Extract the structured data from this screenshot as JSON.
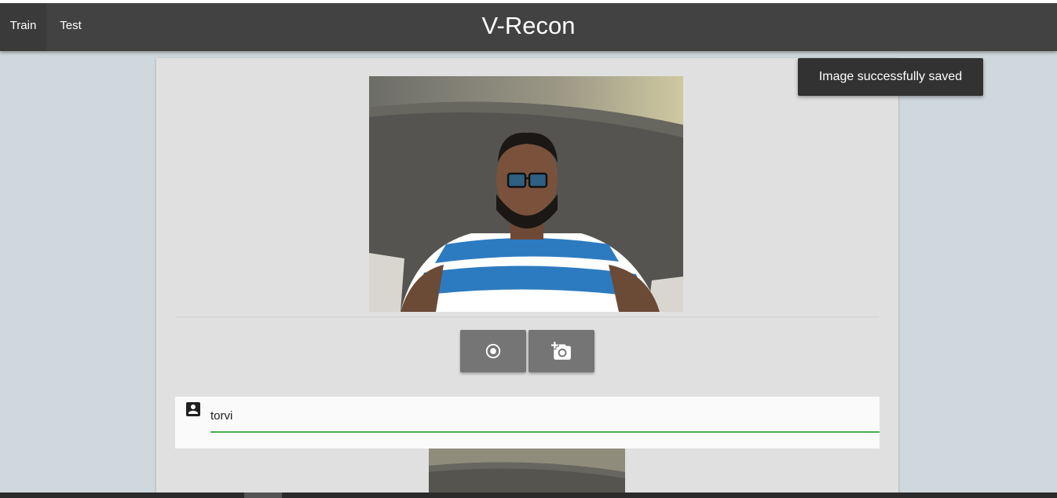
{
  "appbar": {
    "title": "V-Recon",
    "tabs": [
      {
        "label": "Train",
        "active": true
      },
      {
        "label": "Test",
        "active": false
      }
    ]
  },
  "webcam": {
    "buttons": {
      "record_icon": "record-icon",
      "capture_icon": "add-a-photo-icon"
    }
  },
  "name_field": {
    "icon": "account-box-icon",
    "value": "torvi",
    "underline_color": "#4caf50"
  },
  "toast": {
    "message": "Image successfully saved"
  },
  "colors": {
    "appbar": "#424242",
    "background": "#cfd8dc",
    "card": "#e0e0e0",
    "button": "#757575",
    "toast": "#323232"
  }
}
